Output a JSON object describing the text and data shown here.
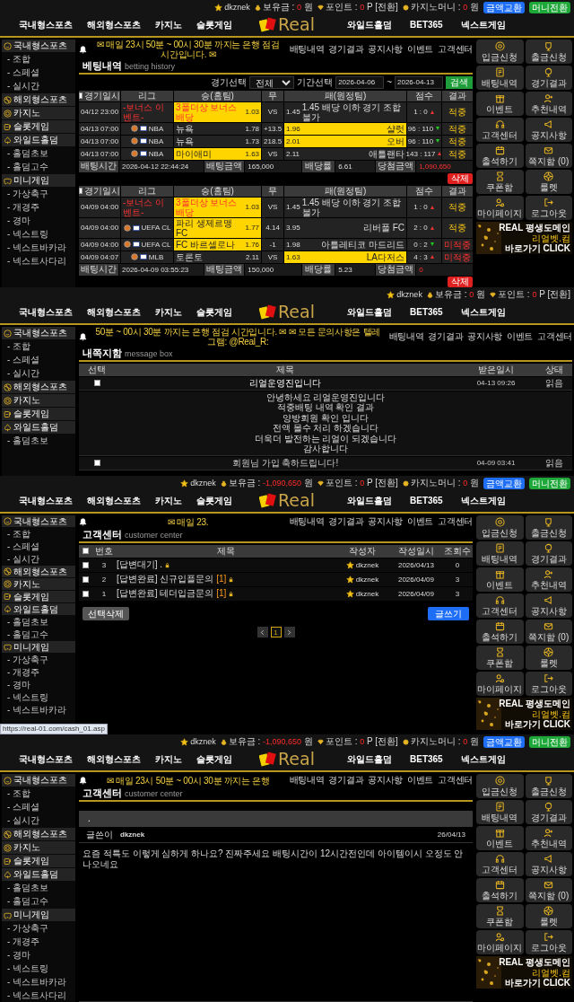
{
  "screens": [
    {
      "user_bar": {
        "username": "dkznek",
        "items": [
          {
            "label": "보유금 :",
            "value": "0",
            "unit": "원"
          },
          {
            "label": "포인트 :",
            "value": "0",
            "unit": "P [전환]"
          },
          {
            "label": "카지노머니 :",
            "value": "0",
            "unit": "원"
          }
        ],
        "buttons": [
          {
            "label": "금액교환",
            "kind": "primary"
          },
          {
            "label": "머니전환",
            "kind": "success"
          }
        ]
      },
      "nav": {
        "left": [
          "국내형스포츠",
          "해외형스포츠",
          "카지노",
          "슬롯게임"
        ],
        "logo": "Real",
        "right": [
          "와일드홀덤",
          "BET365",
          "넥스트게임"
        ]
      },
      "sidebar": [
        {
          "label": "국내형스포츠",
          "children": [
            "- 조합",
            "- 스페셜",
            "- 실시간"
          ]
        },
        {
          "label": "해외형스포츠"
        },
        {
          "label": "카지노"
        },
        {
          "label": "슬롯게임"
        },
        {
          "label": "와일드홀덤",
          "children": [
            "- 홀덤초보",
            "- 홀덤고수"
          ]
        },
        {
          "label": "미니게임",
          "children": [
            "- 가상축구",
            "- 개경주",
            "- 경마",
            "- 넥스트링",
            "- 넥스트바카라",
            "- 넥스트사다리"
          ]
        }
      ],
      "ticker": "✉ 매일 23시 50분 ~ 00시 30분 까지는 은행 점검 시간입니다. ✉",
      "links": [
        "배팅내역",
        "경기결과",
        "공지사항",
        "이벤트",
        "고객센터"
      ],
      "title": "베팅내역",
      "subtitle": "betting history",
      "content": {
        "kind": "betting",
        "filter": {
          "game_label": "경기선택",
          "game_value": "전체",
          "period_label": "기간선택",
          "from": "2026-04-06",
          "sep": "~",
          "to": "2026-04-13",
          "button": "검색"
        },
        "bets": [
          {
            "header_checked": false,
            "columns": [
              "경기일시",
              "리그",
              "승(홈팀)",
              "무",
              "패(원정팀)",
              "점수",
              "결과"
            ],
            "rows": [
              {
                "kind": "bonus",
                "date": "04/12 23:00",
                "league": "-보너스 이벤트-",
                "home": {
                  "name": "3폴더상 보너스 배당",
                  "odds": "1.03",
                  "selected": true
                },
                "middle": "VS",
                "away": {
                  "odds": "1.45",
                  "name": "1.45 배당 이하 경기 조합 불가",
                  "selected": false
                },
                "score": {
                  "text": "1 : 0",
                  "home_won": true
                },
                "result": {
                  "text": "적중",
                  "won": true
                }
              },
              {
                "kind": "match",
                "date": "04/13 07:00",
                "league": "NBA",
                "home": {
                  "name": "뉴욕",
                  "odds": "1.78",
                  "selected": false
                },
                "middle": "+13.5",
                "away": {
                  "odds": "1.96",
                  "name": "샬럿",
                  "selected": true
                },
                "score": {
                  "text": "96 : 110",
                  "home_won": false
                },
                "result": {
                  "text": "적중",
                  "won": true
                }
              },
              {
                "kind": "match",
                "date": "04/13 07:00",
                "league": "NBA",
                "home": {
                  "name": "뉴욕",
                  "odds": "1.73",
                  "selected": false
                },
                "middle": "218.5",
                "away": {
                  "odds": "2.01",
                  "name": "오버",
                  "selected": true
                },
                "score": {
                  "text": "96 : 110",
                  "home_won": false
                },
                "result": {
                  "text": "적중",
                  "won": true
                }
              },
              {
                "kind": "match",
                "date": "04/13 07:00",
                "league": "NBA",
                "home": {
                  "name": "마이애미",
                  "odds": "1.63",
                  "selected": true
                },
                "middle": "VS",
                "away": {
                  "odds": "2.11",
                  "name": "애틀랜타",
                  "selected": false
                },
                "score": {
                  "text": "143 : 117",
                  "home_won": true
                },
                "result": {
                  "text": "적중",
                  "won": true
                }
              }
            ],
            "summary": [
              {
                "label": "배팅시간",
                "value": "2026-04-12 22:44:24",
                "highlight": false
              },
              {
                "label": "배팅금액",
                "value": "165,000",
                "highlight": false
              },
              {
                "label": "배당률",
                "value": "6.61",
                "highlight": false
              },
              {
                "label": "당첨금액",
                "value": "1,090,650",
                "highlight": true
              }
            ],
            "delete": "삭제"
          },
          {
            "header_checked": false,
            "columns": [
              "경기일시",
              "리그",
              "승(홈팀)",
              "무",
              "패(원정팀)",
              "점수",
              "결과"
            ],
            "rows": [
              {
                "kind": "bonus",
                "date": "04/09 04:00",
                "league": "-보너스 이벤트-",
                "home": {
                  "name": "3폴더상 보너스 배당",
                  "odds": "1.03",
                  "selected": true
                },
                "middle": "VS",
                "away": {
                  "odds": "1.45",
                  "name": "1.45 배당 이하 경기 조합 불가",
                  "selected": false
                },
                "score": {
                  "text": "1 : 0",
                  "home_won": true
                },
                "result": {
                  "text": "적중",
                  "won": true
                }
              },
              {
                "kind": "match",
                "date": "04/09 04:00",
                "league": "UEFA CL",
                "home": {
                  "name": "파리 생제르맹 FC",
                  "odds": "1.77",
                  "selected": true
                },
                "middle": "4.14",
                "away": {
                  "odds": "3.95",
                  "name": "리버풀 FC",
                  "selected": false
                },
                "score": {
                  "text": "2 : 0",
                  "home_won": true
                },
                "result": {
                  "text": "적중",
                  "won": true
                }
              },
              {
                "kind": "match",
                "date": "04/09 04:00",
                "league": "UEFA CL",
                "home": {
                  "name": "FC 바르셀로나",
                  "odds": "1.76",
                  "selected": true
                },
                "middle": "-1",
                "away": {
                  "odds": "1.98",
                  "name": "아틀레티코 마드리드",
                  "selected": false
                },
                "score": {
                  "text": "0 : 2",
                  "home_won": false
                },
                "result": {
                  "text": "미적중",
                  "won": false
                }
              },
              {
                "kind": "match",
                "date": "04/09 04:07",
                "league": "MLB",
                "home": {
                  "name": "토론토",
                  "odds": "2.11",
                  "selected": false
                },
                "middle": "VS",
                "away": {
                  "odds": "1.63",
                  "name": "LA다저스",
                  "selected": true
                },
                "score": {
                  "text": "4 : 3",
                  "home_won": true
                },
                "result": {
                  "text": "미적중",
                  "won": false
                }
              }
            ],
            "summary": [
              {
                "label": "배팅시간",
                "value": "2026-04-09 03:55:23",
                "highlight": false
              },
              {
                "label": "배팅금액",
                "value": "150,000",
                "highlight": false
              },
              {
                "label": "배당률",
                "value": "5.23",
                "highlight": false
              },
              {
                "label": "당첨금액",
                "value": "0",
                "highlight": true
              }
            ],
            "delete": "삭제"
          }
        ]
      },
      "quick_menu": {
        "items": [
          "입금신청",
          "출금신청",
          "배팅내역",
          "경기결과",
          "이벤트",
          "추천내역",
          "고객센터",
          "공지사항",
          "출석하기",
          "쪽지함 (0)",
          "쿠폰함",
          "룰렛",
          "마이페이지",
          "로그아웃"
        ],
        "banner": {
          "title": "REAL 평생도메인",
          "domain": "리얼벳.컴",
          "link": "바로가기 CLICK"
        }
      }
    },
    {
      "user_bar": {
        "username": "dkznek",
        "items": [
          {
            "label": "보유금 :",
            "value": "0",
            "unit": "원"
          },
          {
            "label": "포인트 :",
            "value": "0",
            "unit": "P [전환]"
          }
        ]
      },
      "nav": {
        "left": [
          "국내형스포츠",
          "해외형스포츠",
          "카지노",
          "슬롯게임"
        ],
        "logo": "Real",
        "right": [
          "와일드홀덤",
          "BET365",
          "넥스트게임"
        ]
      },
      "sidebar": [
        {
          "label": "국내형스포츠",
          "children": [
            "- 조합",
            "- 스페셜",
            "- 실시간"
          ]
        },
        {
          "label": "해외형스포츠"
        },
        {
          "label": "카지노"
        },
        {
          "label": "슬롯게임"
        },
        {
          "label": "와일드홀덤",
          "children": [
            "- 홀덤초보"
          ]
        }
      ],
      "ticker": "50분 ~ 00시 30분 까지는 은행 점검 시간입니다. ✉  ✉ 모든 문의사항은 텔레그램: @Real_R:",
      "links": [
        "배팅내역",
        "경기결과",
        "공지사항",
        "이벤트",
        "고객센터"
      ],
      "title": "내쪽지함",
      "subtitle": "message box",
      "content": {
        "kind": "messages",
        "columns": [
          "선택",
          "제목",
          "받은일시",
          "상태"
        ],
        "rows": [
          {
            "checked": false,
            "subject": "리얼운영진입니다",
            "date": "04-13 09:26",
            "status": "읽음",
            "expanded": true,
            "body": [
              "안녕하세요 리얼운영진입니다",
              "적중배팅 내역 확인 결과",
              "양방회원 확인 입니다",
              "전액 몰수 처리 하겠습니다",
              "더욱더 발전하는 리얼이 되겠습니다",
              "감사합니다"
            ]
          },
          {
            "checked": false,
            "subject": "회원님 가입 축하드립니다!",
            "date": "04-09 03:41",
            "status": "읽음",
            "expanded": false
          }
        ]
      }
    },
    {
      "user_bar": {
        "username": "dkznek",
        "items": [
          {
            "label": "보유금 :",
            "value": "-1,090,650",
            "unit": "원"
          },
          {
            "label": "포인트 :",
            "value": "0",
            "unit": "P [전환]"
          },
          {
            "label": "카지노머니 :",
            "value": "0",
            "unit": "원"
          }
        ],
        "buttons": [
          {
            "label": "금액교환",
            "kind": "primary"
          },
          {
            "label": "머니전환",
            "kind": "success"
          }
        ]
      },
      "nav": {
        "left": [
          "국내형스포츠",
          "해외형스포츠",
          "카지노",
          "슬롯게임"
        ],
        "logo": "Real",
        "right": [
          "와일드홀덤",
          "BET365",
          "넥스트게임"
        ]
      },
      "sidebar": [
        {
          "label": "국내형스포츠",
          "children": [
            "- 조합",
            "- 스페셜",
            "- 실시간"
          ]
        },
        {
          "label": "해외형스포츠"
        },
        {
          "label": "카지노"
        },
        {
          "label": "슬롯게임"
        },
        {
          "label": "와일드홀덤",
          "children": [
            "- 홀덤초보",
            "- 홀덤고수"
          ]
        },
        {
          "label": "미니게임",
          "children": [
            "- 가상축구",
            "- 개경주",
            "- 경마",
            "- 넥스트링",
            "- 넥스트바카라"
          ]
        }
      ],
      "ticker": "✉ 매일 23.",
      "links": [
        "배팅내역",
        "경기결과",
        "공지사항",
        "이벤트",
        "고객센터"
      ],
      "title": "고객센터",
      "subtitle": "customer center",
      "content": {
        "kind": "board",
        "all_checked": false,
        "columns": [
          "번호",
          "제목",
          "작성자",
          "작성일시",
          "조회수"
        ],
        "rows": [
          {
            "checked": false,
            "number": "3",
            "tag": "[답변대기]",
            "subject": ".",
            "author": "dkznek",
            "date": "2026/04/13",
            "views": "0"
          },
          {
            "checked": false,
            "number": "2",
            "tag": "[답변완료]",
            "subject": "신규입플문의",
            "comments": "[1]",
            "author": "dkznek",
            "date": "2026/04/09",
            "views": "3"
          },
          {
            "checked": false,
            "number": "1",
            "tag": "[답변완료]",
            "subject": "테더입금문의",
            "comments": "[1]",
            "author": "dkznek",
            "date": "2026/04/09",
            "views": "3"
          }
        ],
        "delete_button": "선택삭제",
        "write_button": "글쓰기",
        "pages": [
          {
            "label": "1",
            "selected": true
          }
        ]
      },
      "quick_menu": {
        "items": [
          "입금신청",
          "출금신청",
          "배팅내역",
          "경기결과",
          "이벤트",
          "추천내역",
          "고객센터",
          "공지사항",
          "출석하기",
          "쪽지함 (0)",
          "쿠폰함",
          "룰렛",
          "마이페이지",
          "로그아웃"
        ],
        "banner": {
          "title": "REAL 평생도메인",
          "domain": "리얼벳.컴",
          "link": "바로가기 CLICK"
        }
      },
      "status_url": "https://real-01.com/cash_01.asp"
    },
    {
      "user_bar": {
        "username": "dkznek",
        "items": [
          {
            "label": "보유금 :",
            "value": "-1,090,650",
            "unit": "원"
          },
          {
            "label": "포인트 :",
            "value": "0",
            "unit": "P [전환]"
          },
          {
            "label": "카지노머니 :",
            "value": "0",
            "unit": "원"
          }
        ],
        "buttons": [
          {
            "label": "금액교환",
            "kind": "primary"
          },
          {
            "label": "머니전환",
            "kind": "success"
          }
        ]
      },
      "nav": {
        "left": [
          "국내형스포츠",
          "해외형스포츠",
          "카지노",
          "슬롯게임"
        ],
        "logo": "Real",
        "right": [
          "와일드홀덤",
          "BET365",
          "넥스트게임"
        ]
      },
      "sidebar": [
        {
          "label": "국내형스포츠",
          "children": [
            "- 조합",
            "- 스페셜",
            "- 실시간"
          ]
        },
        {
          "label": "해외형스포츠"
        },
        {
          "label": "카지노"
        },
        {
          "label": "슬롯게임"
        },
        {
          "label": "와일드홀덤",
          "children": [
            "- 홀덤초보",
            "- 홀덤고수"
          ]
        },
        {
          "label": "미니게임",
          "children": [
            "- 가상축구",
            "- 개경주",
            "- 경마",
            "- 넥스트링",
            "- 넥스트바카라",
            "- 넥스트사다리"
          ]
        }
      ],
      "ticker": "✉ 매일 23시 50분 ~ 00시 30분 까지는 은행",
      "links": [
        "배팅내역",
        "경기결과",
        "공지사항",
        "이벤트",
        "고객센터"
      ],
      "title": "고객센터",
      "subtitle": "customer center",
      "content": {
        "kind": "post",
        "subject": ".",
        "author_label": "글쓴이",
        "author": "dkznek",
        "date": "26/04/13",
        "body": "요즘 적특도 이렇게 심하게 하나요? 진짜주세요 배팅시간이 12시간전인데 아이템이시 오정도 안나오네요"
      },
      "quick_menu": {
        "items": [
          "입금신청",
          "출금신청",
          "배팅내역",
          "경기결과",
          "이벤트",
          "추천내역",
          "고객센터",
          "공지사항",
          "출석하기",
          "쪽지함 (0)",
          "쿠폰함",
          "룰렛",
          "마이페이지",
          "로그아웃"
        ],
        "banner": {
          "title": "REAL 평생도메인",
          "domain": "리얼벳.컴",
          "link": "바로가기 CLICK"
        }
      }
    }
  ]
}
